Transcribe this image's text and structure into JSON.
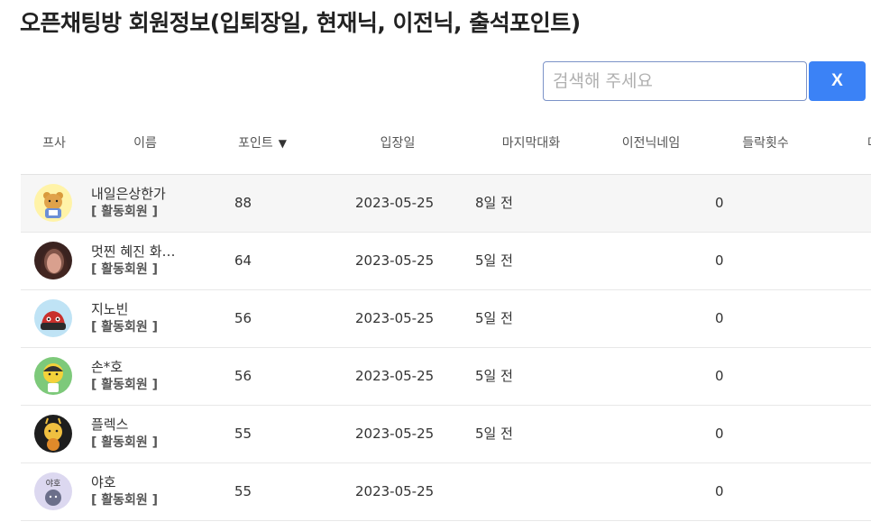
{
  "header": {
    "title": "오픈채팅방 회원정보(입퇴장일, 현재닉, 이전닉, 출석포인트)"
  },
  "search": {
    "placeholder": "검색해 주세요",
    "value": "",
    "clear_label": "X"
  },
  "table": {
    "columns": {
      "avatar": "프사",
      "name": "이름",
      "points": "포인트",
      "points_sort": "▼",
      "join_date": "입장일",
      "last_chat": "마지막대화",
      "prev_nick": "이전닉네임",
      "kick_count": "들락횟수",
      "cut_off": "마"
    },
    "rows": [
      {
        "name": "내일은상한가",
        "badge": "[ 활동회원 ]",
        "points": "88",
        "join_date": "2023-05-25",
        "last_chat": "8일 전",
        "prev_nick": "",
        "kick_count": "0",
        "avatar_icon": "ryan-character-icon"
      },
      {
        "name": "멋찐 혜진 화…",
        "badge": "[ 활동회원 ]",
        "points": "64",
        "join_date": "2023-05-25",
        "last_chat": "5일 전",
        "prev_nick": "",
        "kick_count": "0",
        "avatar_icon": "profile-photo-icon"
      },
      {
        "name": "지노빈",
        "badge": "[ 활동회원 ]",
        "points": "56",
        "join_date": "2023-05-25",
        "last_chat": "5일 전",
        "prev_nick": "",
        "kick_count": "0",
        "avatar_icon": "car-character-icon"
      },
      {
        "name": "손*호",
        "badge": "[ 활동회원 ]",
        "points": "56",
        "join_date": "2023-05-25",
        "last_chat": "5일 전",
        "prev_nick": "",
        "kick_count": "0",
        "avatar_icon": "yellow-character-icon"
      },
      {
        "name": "플렉스",
        "badge": "[ 활동회원 ]",
        "points": "55",
        "join_date": "2023-05-25",
        "last_chat": "5일 전",
        "prev_nick": "",
        "kick_count": "0",
        "avatar_icon": "bee-character-icon"
      },
      {
        "name": "야호",
        "badge": "[ 활동회원 ]",
        "points": "55",
        "join_date": "2023-05-25",
        "last_chat": "",
        "prev_nick": "",
        "kick_count": "0",
        "avatar_icon": "yaho-character-icon"
      }
    ]
  },
  "colors": {
    "accent": "#3b82f6",
    "input_border": "#7c93c8",
    "first_row_bg": "#f6f6f6"
  }
}
